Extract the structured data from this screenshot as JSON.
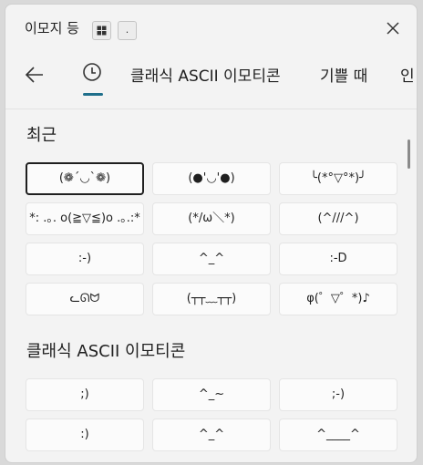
{
  "window": {
    "title": "이모지 등",
    "shortcut_win_icon": "windows-logo-icon",
    "shortcut_dot_label": "."
  },
  "tabs": [
    {
      "label": "",
      "icon": "clock-icon",
      "active": true
    },
    {
      "label": "클래식 ASCII 이모티콘"
    },
    {
      "label": "기쁠 때"
    },
    {
      "label": "인"
    }
  ],
  "sections": {
    "recent": {
      "title": "최근",
      "items": [
        "(❁´◡`❁)",
        "(●'◡'●)",
        "╰(*°▽°*)╯",
        "*: .｡. o(≧▽≦)o .｡.:*",
        "(*/ω＼*)",
        "(^///^)",
        ":-)",
        "^_^",
        ":-D",
        "ᓚᘏᗢ",
        "(┬┬﹏┬┬)",
        "φ(゜▽゜*)♪"
      ]
    },
    "classic": {
      "title": "클래식 ASCII 이모티콘",
      "items": [
        ";)",
        "^_~",
        ";-)",
        ":)",
        "^_^",
        "^____^"
      ]
    }
  },
  "colors": {
    "accent": "#1f6f8b",
    "background": "#f3f3f3"
  }
}
